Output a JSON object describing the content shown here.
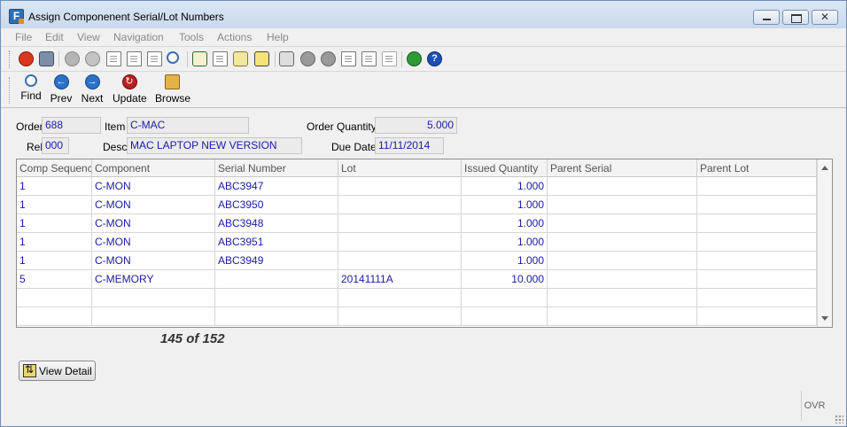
{
  "window": {
    "title": "Assign Componenent Serial/Lot Numbers"
  },
  "menu": [
    "File",
    "Edit",
    "View",
    "Navigation",
    "Tools",
    "Actions",
    "Help"
  ],
  "toolbar": {
    "icons": [
      "power-icon",
      "windows-icon",
      "check-icon",
      "cancel-icon",
      "copy-icon",
      "paste-icon",
      "doc-grid-icon",
      "zoom-icon",
      "notes-icon",
      "attach-icon",
      "edit-icon",
      "calendar-icon",
      "upload-icon",
      "down-icon",
      "up-icon",
      "doc-out-icon",
      "doc-in-icon",
      "doc-stack-icon",
      "chart-icon",
      "help-icon"
    ]
  },
  "nav": {
    "find": "Find",
    "prev": "Prev",
    "next": "Next",
    "update": "Update",
    "browse": "Browse"
  },
  "form": {
    "order_label": "Order",
    "order_value": "688",
    "item_label": "Item",
    "item_value": "C-MAC",
    "order_qty_label": "Order Quantity",
    "order_qty_value": "5.000",
    "rel_label": "Rel",
    "rel_value": "000",
    "desc_label": "Desc",
    "desc_value": "MAC LAPTOP  NEW VERSION",
    "due_date_label": "Due Date",
    "due_date_value": "11/11/2014"
  },
  "grid": {
    "columns": [
      "Comp Sequence",
      "Component",
      "Serial Number",
      "Lot",
      "Issued Quantity",
      "Parent Serial",
      "Parent Lot"
    ],
    "rows": [
      [
        "1",
        "C-MON",
        "ABC3947",
        "",
        "1.000",
        "",
        ""
      ],
      [
        "1",
        "C-MON",
        "ABC3950",
        "",
        "1.000",
        "",
        ""
      ],
      [
        "1",
        "C-MON",
        "ABC3948",
        "",
        "1.000",
        "",
        ""
      ],
      [
        "1",
        "C-MON",
        "ABC3951",
        "",
        "1.000",
        "",
        ""
      ],
      [
        "1",
        "C-MON",
        "ABC3949",
        "",
        "1.000",
        "",
        ""
      ],
      [
        "5",
        "C-MEMORY",
        "",
        "20141111A",
        "10.000",
        "",
        ""
      ],
      [
        "",
        "",
        "",
        "",
        "",
        "",
        ""
      ],
      [
        "",
        "",
        "",
        "",
        "",
        "",
        ""
      ]
    ]
  },
  "record_count": "145 of 152",
  "view_detail": "View Detail",
  "status": {
    "mode": "OVR"
  }
}
